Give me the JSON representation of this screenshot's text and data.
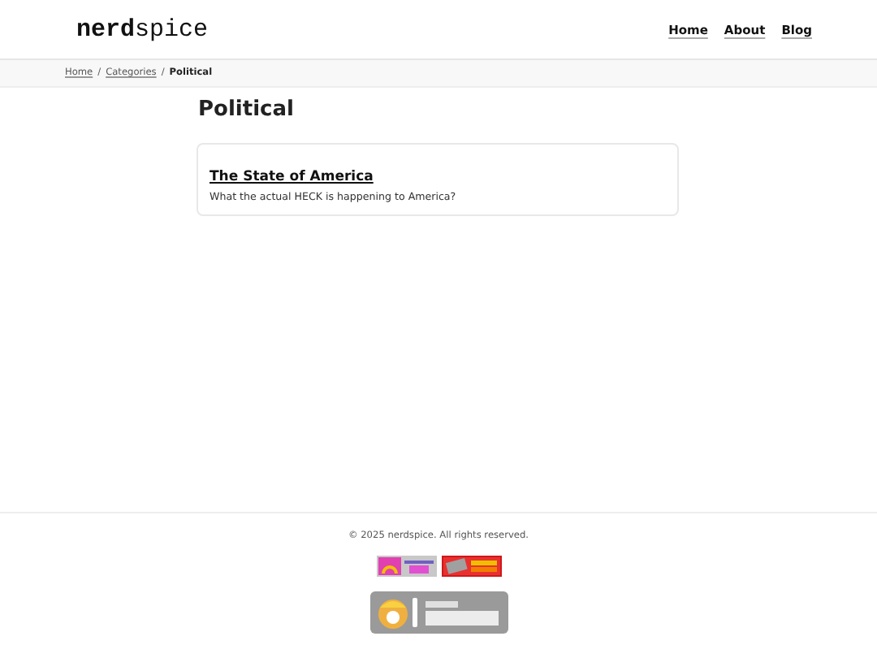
{
  "header": {
    "logo": "**nerd**spice",
    "nav": [
      {
        "label": "Home"
      },
      {
        "label": "About"
      },
      {
        "label": "Blog"
      }
    ]
  },
  "breadcrumb": [
    {
      "label": "Home",
      "kind": "link"
    },
    {
      "label": "/",
      "kind": "separator"
    },
    {
      "label": "Categories",
      "kind": "link"
    },
    {
      "label": "/",
      "kind": "separator"
    },
    {
      "label": "Political",
      "kind": "current"
    }
  ],
  "heading": "Political",
  "posts": [
    {
      "title": "The State of America",
      "summary": "What the actual HECK is happening to America?"
    }
  ],
  "footer": {
    "copyright": "© 2025 nerdspice. All rights reserved."
  }
}
